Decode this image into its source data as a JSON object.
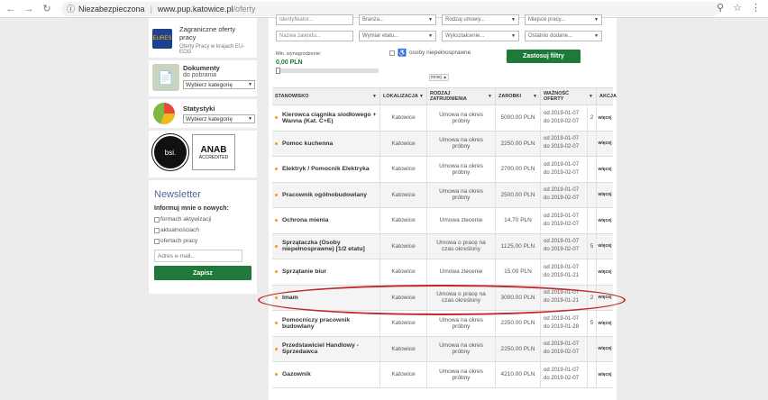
{
  "browser": {
    "security_label": "Niezabezpieczona",
    "url_host": "www.pup.katowice.pl",
    "url_path": "/oferty"
  },
  "sidebar": {
    "foreign": {
      "title": "Zagraniczne oferty pracy",
      "subtitle": "Oferty Pracy w krajach EU-EOG",
      "logo_text": "EURES"
    },
    "documents": {
      "title": "Dokumenty",
      "subtitle": "do pobrania",
      "select": "Wybierz kategorię"
    },
    "stats": {
      "title": "Statystyki",
      "select": "Wybierz kategorię"
    },
    "cert": {
      "bsi": "bsi.",
      "anab": "ANAB",
      "anab_sub": "ACCREDITED"
    },
    "newsletter": {
      "title": "Newsletter",
      "label": "Informuj mnie o nowych:",
      "options": [
        "formach aktywizacji",
        "aktualnościach",
        "ofertach pracy"
      ],
      "email_placeholder": "Adres e-mail...",
      "save": "Zapisz"
    }
  },
  "filters": {
    "row1": [
      "Identyfikator...",
      "Branża...",
      "Rodzaj umowy...",
      "Miejsce pracy..."
    ],
    "row2": [
      "Nazwa zawodu...",
      "Wymiar etatu...",
      "Wykształcenie...",
      "Ostatnio dodane..."
    ],
    "pay_label": "Min. wynagrodzenie:",
    "pay_value": "0,00 PLN",
    "disabled_label": "osoby niepełnosprawne",
    "apply": "Zastosuj filtry",
    "less": "mniej ▲"
  },
  "table": {
    "headers": [
      "STANOWISKO",
      "LOKALIZACJA",
      "RODZAJ ZATRUDNIENIA",
      "ZAROBKI",
      "WAŻNOŚĆ OFERTY",
      "AKCJA"
    ],
    "rows": [
      {
        "title": "Kierowca ciągnika siodłowego + Wanna (Kat. C+E)",
        "loc": "Katowice",
        "type": "Umowa na okres próbny",
        "pay": "5000.00 PLN",
        "from": "od 2019-01-07",
        "to": "do 2019-02-07",
        "num": "2",
        "act": "więcej"
      },
      {
        "title": "Pomoc kuchenna",
        "loc": "Katowice",
        "type": "Umowa na okres próbny",
        "pay": "2250.00 PLN",
        "from": "od 2019-01-07",
        "to": "do 2019-02-07",
        "num": "",
        "act": "więcej"
      },
      {
        "title": "Elektryk / Pomocnik Elektryka",
        "loc": "Katowice",
        "type": "Umowa na okres próbny",
        "pay": "2700.00 PLN",
        "from": "od 2019-01-07",
        "to": "do 2019-02-07",
        "num": "",
        "act": "więcej"
      },
      {
        "title": "Pracownik ogólnobudowlany",
        "loc": "Katowice",
        "type": "Umowa na okres próbny",
        "pay": "2500.00 PLN",
        "from": "od 2019-01-07",
        "to": "do 2019-02-07",
        "num": "",
        "act": "więcej"
      },
      {
        "title": "Ochrona mienia",
        "loc": "Katowice",
        "type": "Umowa zlecenie",
        "pay": "14.70 PLN",
        "from": "od 2019-01-07",
        "to": "do 2019-02-07",
        "num": "",
        "act": "więcej"
      },
      {
        "title": "Sprzątaczka (Osoby niepełnosprawne) [1/2 etatu]",
        "loc": "Katowice",
        "type": "Umowa o pracę na czas określony",
        "pay": "1125.00 PLN",
        "from": "od 2019-01-07",
        "to": "do 2019-02-07",
        "num": "5",
        "act": "więcej"
      },
      {
        "title": "Sprzątanie biur",
        "loc": "Katowice",
        "type": "Umowa zlecenie",
        "pay": "15.00 PLN",
        "from": "od 2019-01-07",
        "to": "do 2019-01-21",
        "num": "",
        "act": "więcej"
      },
      {
        "title": "Imam",
        "loc": "Katowice",
        "type": "Umowa o pracę na czas określony",
        "pay": "3000.00 PLN",
        "from": "od 2019-01-07",
        "to": "do 2019-01-21",
        "num": "2",
        "act": "więcej"
      },
      {
        "title": "Pomocniczy pracownik budowlany",
        "loc": "Katowice",
        "type": "Umowa na okres próbny",
        "pay": "2250.00 PLN",
        "from": "od 2019-01-07",
        "to": "do 2019-01-28",
        "num": "5",
        "act": "więcej"
      },
      {
        "title": "Przedstawiciel Handlowy - Sprzedawca",
        "loc": "Katowice",
        "type": "Umowa na okres próbny",
        "pay": "2250.00 PLN",
        "from": "od 2019-01-07",
        "to": "do 2019-02-07",
        "num": "",
        "act": "więcej"
      },
      {
        "title": "Gazownik",
        "loc": "Katowice",
        "type": "Umowa na okres próbny",
        "pay": "4210.00 PLN",
        "from": "od 2019-01-07",
        "to": "do 2019-02-07",
        "num": "",
        "act": "więcej"
      }
    ]
  },
  "colors": {
    "accent_green": "#1f7a3a",
    "annotation_red": "#c0282a",
    "dot_orange": "#e8a020"
  }
}
